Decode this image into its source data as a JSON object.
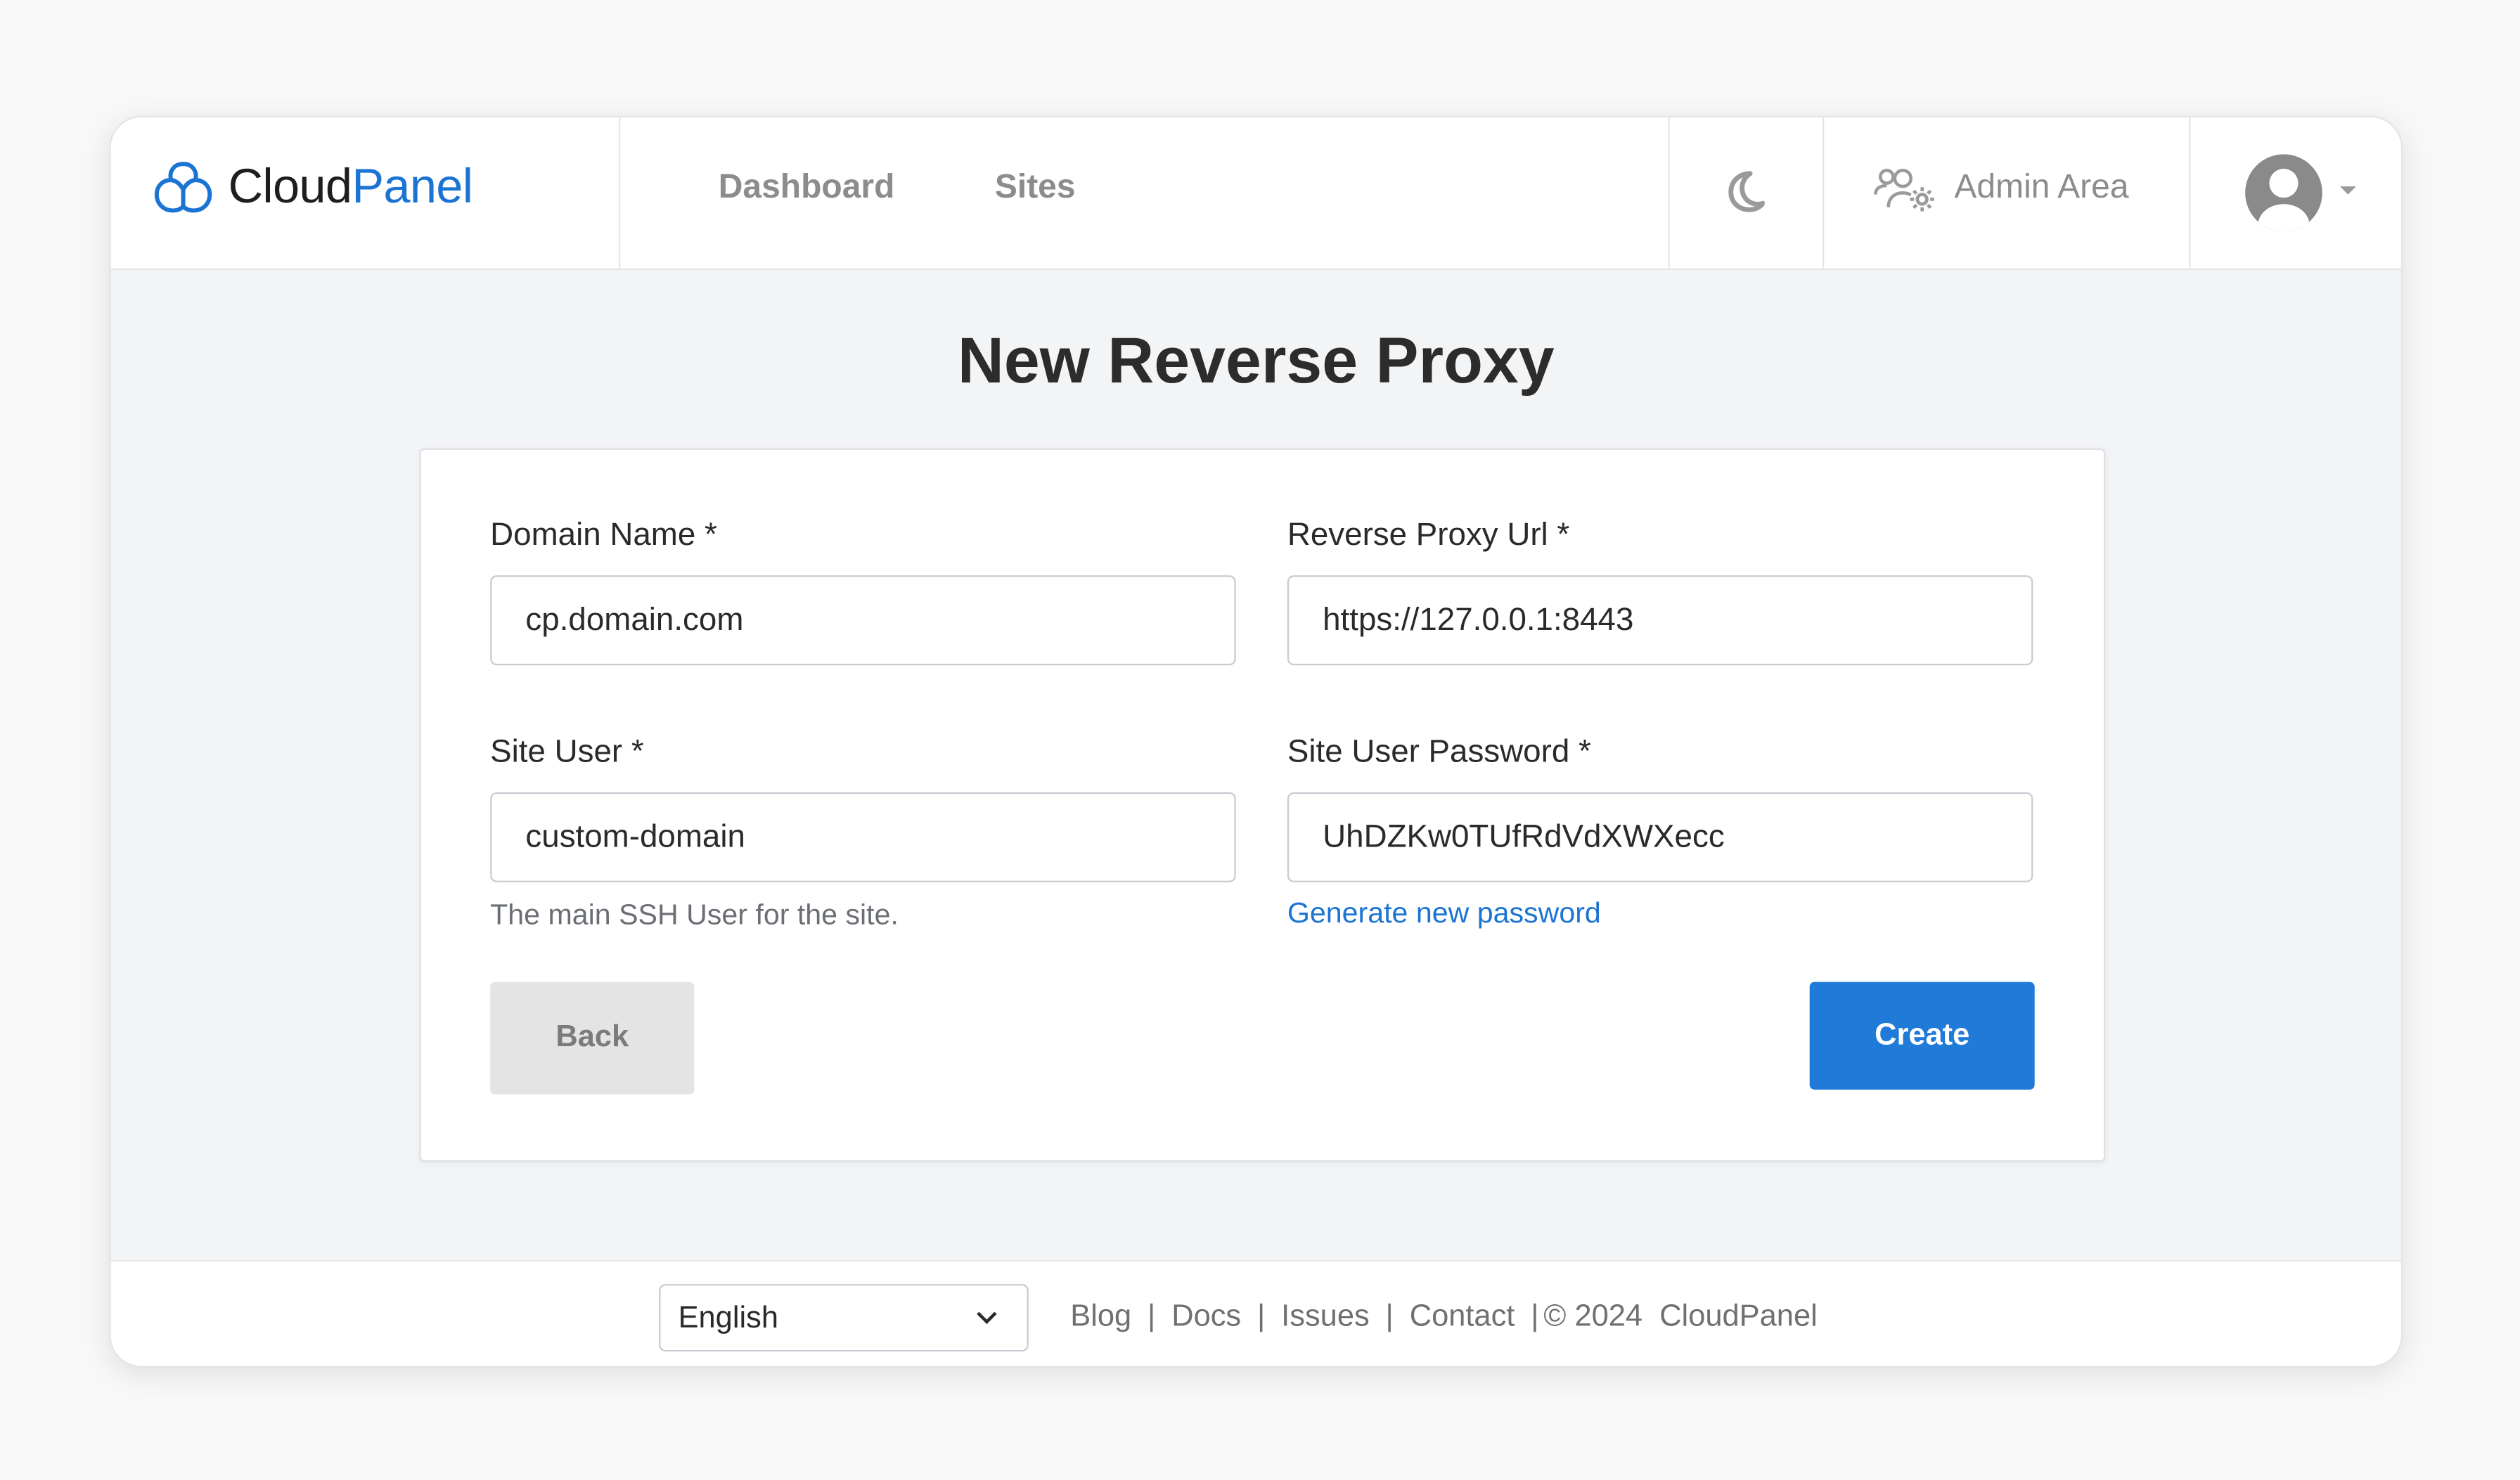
{
  "header": {
    "logo_part1": "Cloud",
    "logo_part2": "Panel",
    "nav": [
      {
        "label": "Dashboard"
      },
      {
        "label": "Sites"
      }
    ],
    "theme_icon": "moon-icon",
    "admin_area_label": "Admin Area",
    "admin_area_icon": "users-gear-icon",
    "user_icon": "user-avatar-icon"
  },
  "main": {
    "title": "New Reverse Proxy",
    "form": {
      "domain_name": {
        "label": "Domain Name *",
        "value": "cp.domain.com"
      },
      "reverse_proxy_url": {
        "label": "Reverse Proxy Url *",
        "value": "https://127.0.0.1:8443"
      },
      "site_user": {
        "label": "Site User *",
        "value": "custom-domain",
        "help": "The main SSH User for the site."
      },
      "site_user_password": {
        "label": "Site User Password *",
        "value": "UhDZKw0TUfRdVdXWXecc",
        "generate_link": "Generate new password"
      },
      "back_label": "Back",
      "create_label": "Create"
    }
  },
  "footer": {
    "language": "English",
    "links": {
      "blog": "Blog",
      "docs": "Docs",
      "issues": "Issues",
      "contact": "Contact"
    },
    "copyright": "© 2024",
    "brand": "CloudPanel"
  },
  "colors": {
    "accent": "#1b74d3",
    "button_primary": "#1f7ad8",
    "button_secondary": "#e4e4e4",
    "background": "#f3f4f6"
  }
}
